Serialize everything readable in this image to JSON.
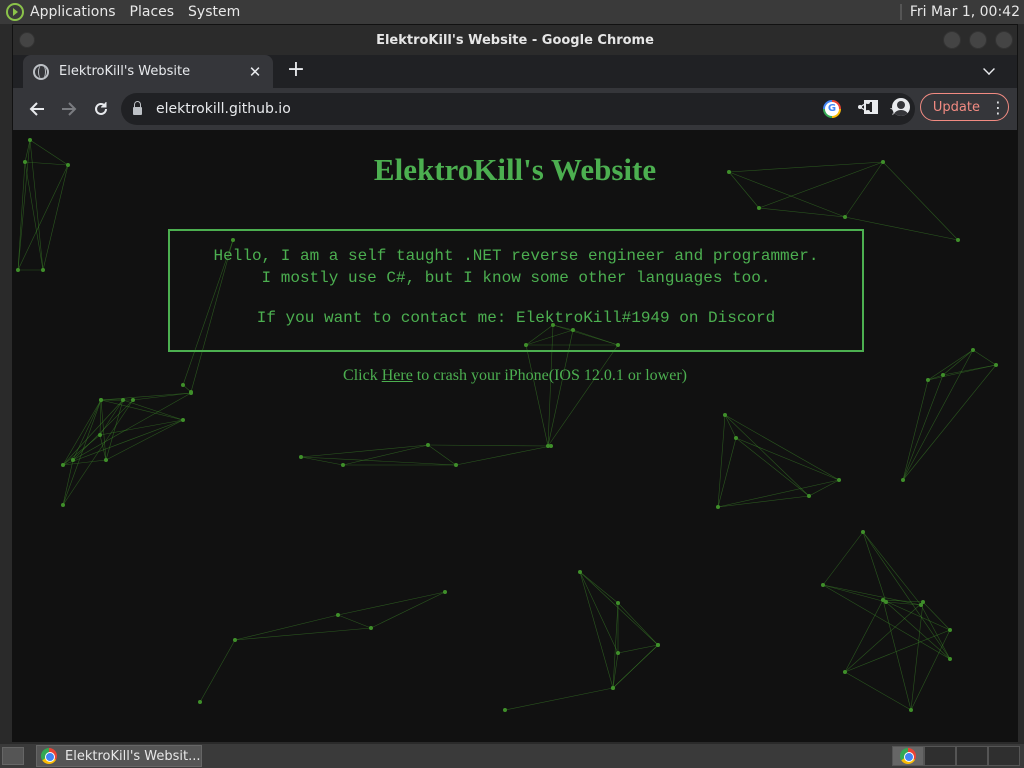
{
  "top_panel": {
    "menus": [
      "Applications",
      "Places",
      "System"
    ],
    "clock": "Fri Mar 1, 00:42"
  },
  "window": {
    "title": "ElektroKill's Website - Google Chrome"
  },
  "tab": {
    "title": "ElektroKill's Website"
  },
  "address_bar": {
    "url": "elektrokill.github.io"
  },
  "toolbar": {
    "update_label": "Update"
  },
  "page": {
    "heading": "ElektroKill's Website",
    "intro_line1": "Hello, I am a self taught .NET reverse engineer and programmer.",
    "intro_line2": "I mostly use C#, but I know some other languages too.",
    "contact_line": "If you want to contact me: ElektroKill#1949 on Discord",
    "crash_prefix": "Click ",
    "crash_link": "Here",
    "crash_suffix": " to crash your iPhone(IOS 12.0.1 or lower)",
    "colors": {
      "accent": "#4caf50",
      "background": "#111111",
      "particle": "#3f8f2a"
    }
  },
  "taskbar": {
    "task_label": "ElektroKill's Websit..."
  }
}
